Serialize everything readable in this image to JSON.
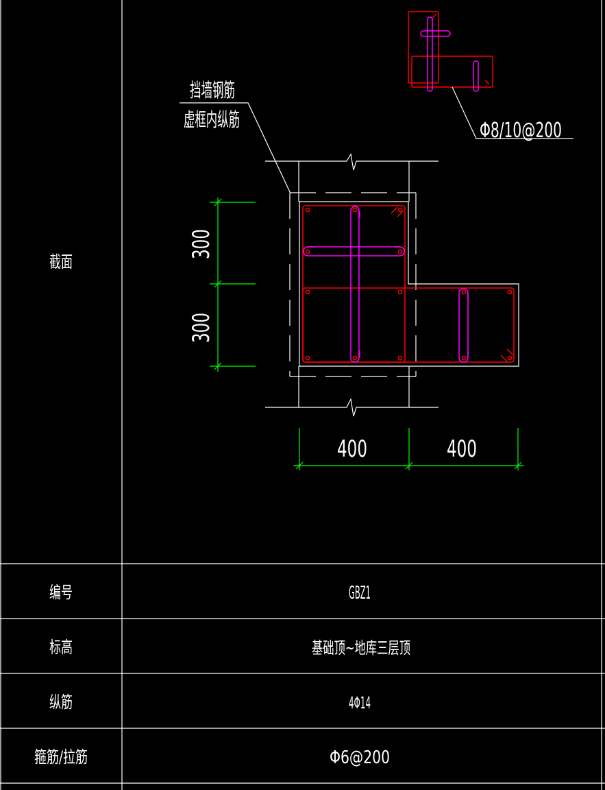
{
  "drawing": {
    "annotation_top": "挡墙钢筋",
    "annotation_bottom": "虚框内纵筋",
    "stirrup_spec": "Φ8/10@200",
    "dim_vertical": [
      "300",
      "300"
    ],
    "dim_horizontal": [
      "400",
      "400"
    ],
    "colors": {
      "background": "#000000",
      "lines": "#ffffff",
      "stirrup": "#ff0000",
      "tie": "#ff00ff",
      "dimension": "#00ff00"
    }
  },
  "table": {
    "section_label": "截面",
    "rows": [
      {
        "label": "编号",
        "value": "GBZ1"
      },
      {
        "label": "标高",
        "value": "基础顶~地库三层顶"
      },
      {
        "label": "纵筋",
        "value": "4Φ14"
      },
      {
        "label": "箍筋/拉筋",
        "value": "Φ6@200"
      }
    ]
  }
}
